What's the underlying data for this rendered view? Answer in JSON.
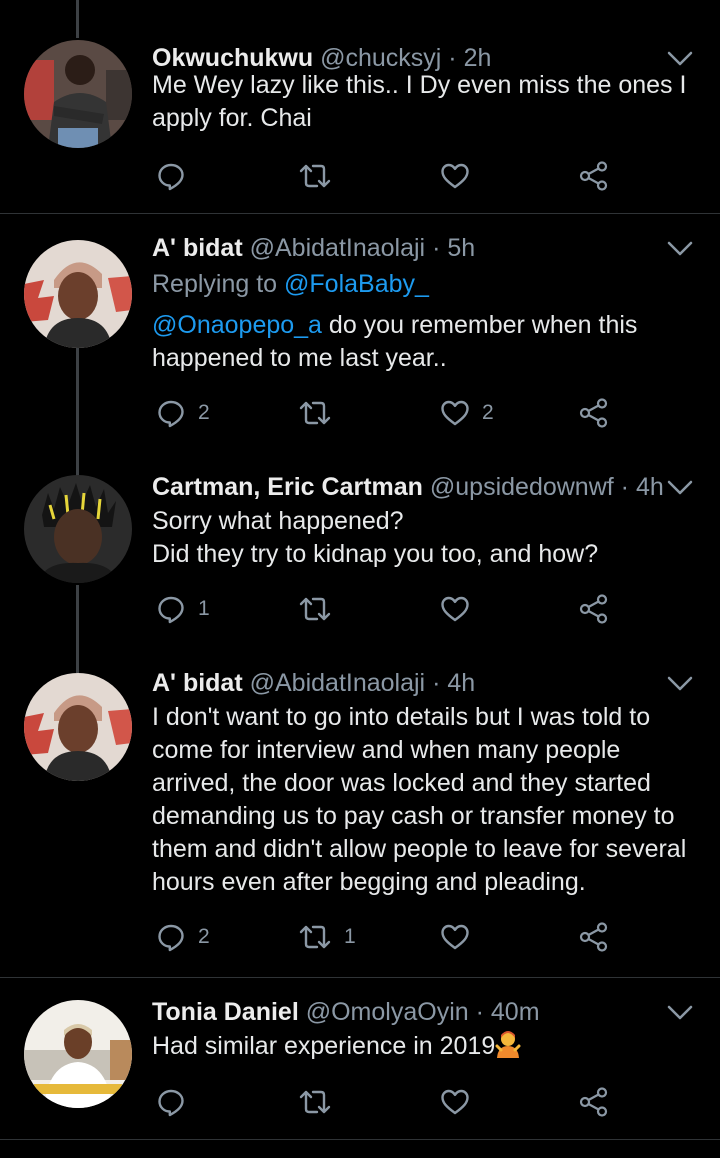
{
  "tweets": [
    {
      "name": "Okwuchukwu",
      "handle": "@chucksyj",
      "time": "2h",
      "lines": [
        "Me Wey lazy like this.. I Dy even miss the ones I",
        "apply for.  Chai"
      ],
      "reply_count": "",
      "retweet_count": "",
      "like_count": ""
    },
    {
      "name": "A' bidat",
      "handle": "@AbidatInaolaji",
      "time": "5h",
      "replying_prefix": "Replying to",
      "replying_to": "@FolaBaby_",
      "mention": "@Onaopepo_a",
      "lines": [
        " do you remember when this",
        "happened to me last year.."
      ],
      "reply_count": "2",
      "retweet_count": "",
      "like_count": "2"
    },
    {
      "name": "Cartman, Eric Cartman",
      "handle": "@upsidedownwf",
      "time": "4h",
      "lines": [
        "Sorry what happened?",
        "Did they try to kidnap you too, and how?"
      ],
      "reply_count": "1",
      "retweet_count": "",
      "like_count": ""
    },
    {
      "name": "A' bidat",
      "handle": "@AbidatInaolaji",
      "time": "4h",
      "lines": [
        "I don't want to go into details but I was told to",
        "come for interview and when many people",
        "arrived, the door was locked and they started",
        "demanding us to pay cash or transfer money to",
        "them and didn't allow people to leave for several",
        "hours even after begging and pleading."
      ],
      "reply_count": "2",
      "retweet_count": "1",
      "like_count": ""
    },
    {
      "name": "Tonia Daniel",
      "handle": "@OmolyaOyin",
      "time": "40m",
      "lines": [
        "Had similar experience in 2019"
      ],
      "emoji": "person-shrugging-emoji",
      "reply_count": "",
      "retweet_count": "",
      "like_count": ""
    }
  ],
  "separator": "·",
  "colors": {
    "background": "#000000",
    "text": "#e7e9ea",
    "secondary": "#8b98a5",
    "link": "#1d9bf0",
    "divider": "#2f3336"
  }
}
